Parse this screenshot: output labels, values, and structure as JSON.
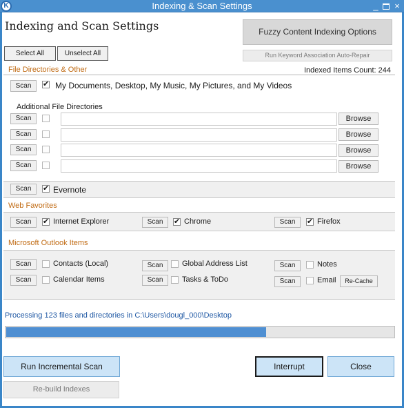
{
  "window": {
    "title": "Indexing & Scan Settings",
    "app_icon": "K",
    "minimize": "_",
    "close": "×"
  },
  "header": {
    "page_title": "Indexing and Scan Settings",
    "fuzzy_button": "Fuzzy Content Indexing Options",
    "repair_button": "Run Keyword Association Auto-Repair",
    "select_all": "Select All",
    "unselect_all": "Unselect All"
  },
  "file_dirs": {
    "section_title": "File Directories & Other",
    "indexed_count": "Indexed Items Count: 244",
    "scan_label": "Scan",
    "my_docs_label": "My Documents, Desktop, My Music, My Pictures, and My Videos",
    "my_docs_checked": true,
    "additional_title": "Additional File Directories",
    "browse_label": "Browse",
    "rows": [
      {
        "path": "",
        "checked": false
      },
      {
        "path": "",
        "checked": false
      },
      {
        "path": "",
        "checked": false
      },
      {
        "path": "",
        "checked": false
      }
    ],
    "evernote_label": "Evernote",
    "evernote_checked": true
  },
  "web_favorites": {
    "section_title": "Web Favorites",
    "items": [
      {
        "label": "Internet Explorer",
        "checked": true
      },
      {
        "label": "Chrome",
        "checked": true
      },
      {
        "label": "Firefox",
        "checked": true
      }
    ]
  },
  "outlook": {
    "section_title": "Microsoft Outlook Items",
    "items": [
      {
        "label": "Contacts (Local)",
        "checked": false
      },
      {
        "label": "Calendar Items",
        "checked": false
      },
      {
        "label": "Global Address List",
        "checked": false
      },
      {
        "label": "Tasks & ToDo",
        "checked": false
      },
      {
        "label": "Notes",
        "checked": false
      },
      {
        "label": "Email",
        "checked": false
      }
    ],
    "recache_label": "Re-Cache"
  },
  "status": {
    "message": "Processing 123 files and directories in C:\\Users\\dougl_000\\Desktop",
    "progress": 0.67
  },
  "footer": {
    "incremental_scan": "Run Incremental Scan",
    "rebuild_indexes": "Re-build Indexes",
    "interrupt": "Interrupt",
    "close": "Close"
  },
  "colors": {
    "title_bar": "#4a90cf",
    "section_heading": "#c06a12",
    "status_text": "#1e57a3",
    "progress_fill": "#4f8fd2",
    "primary_button": "#cce4f7"
  }
}
